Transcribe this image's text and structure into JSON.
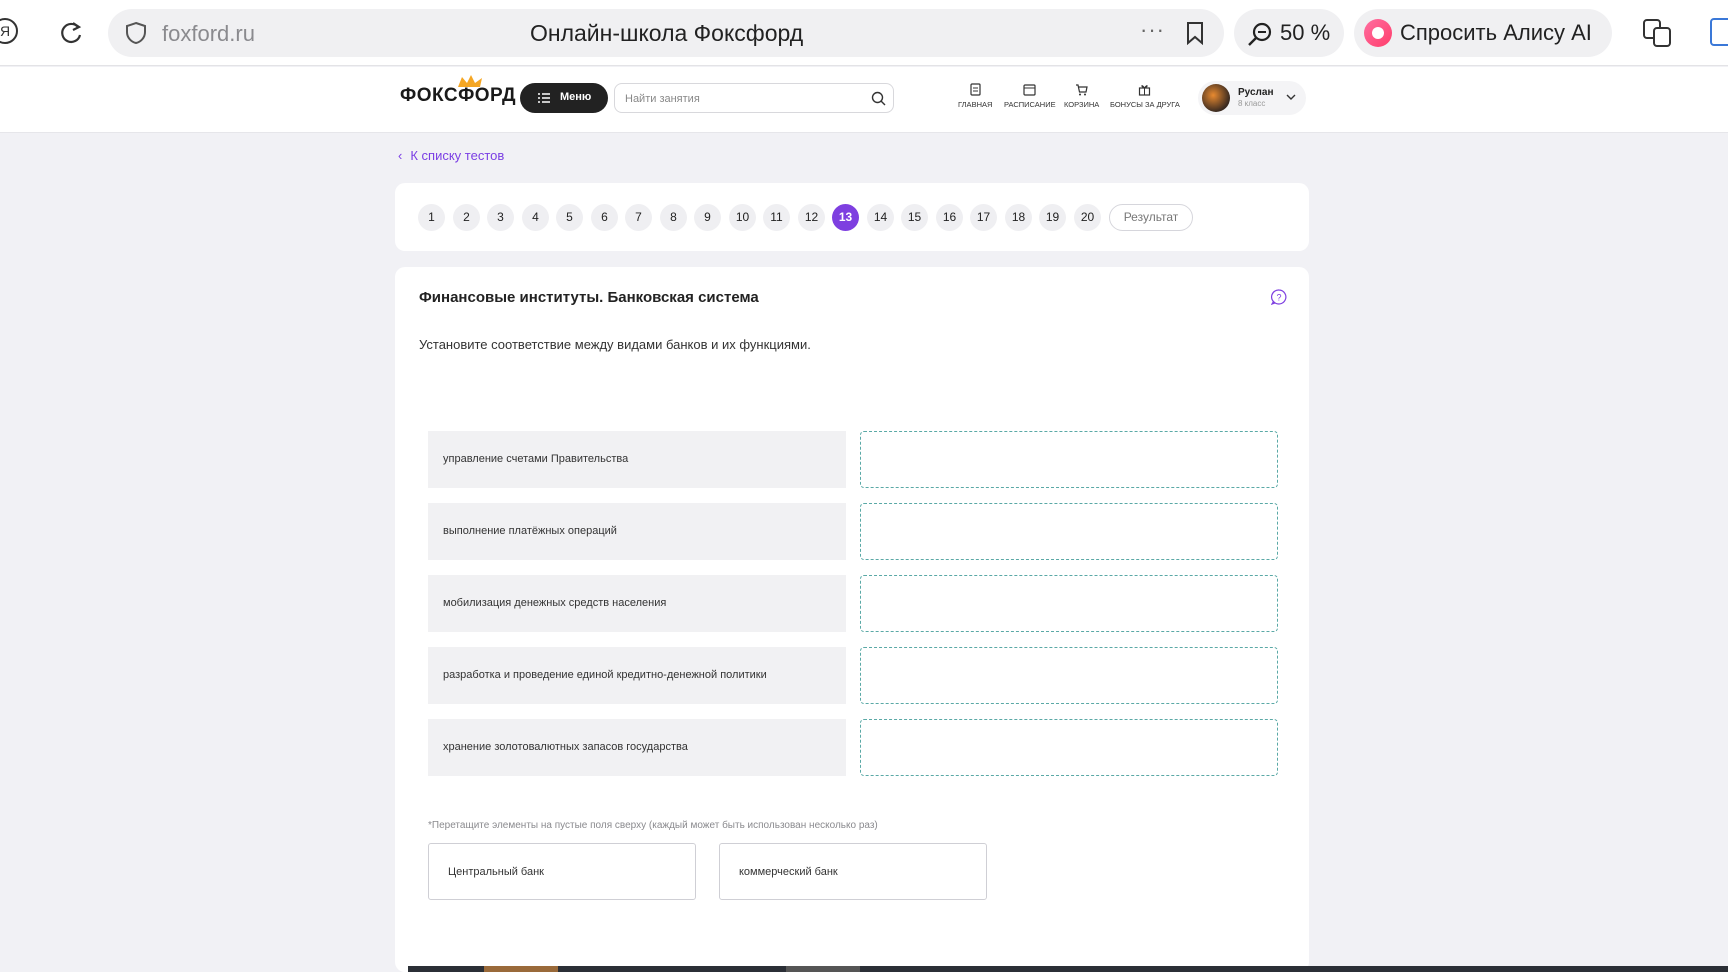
{
  "browser": {
    "host": "foxford.ru",
    "page_title": "Онлайн-школа Фоксфорд",
    "more": "···",
    "zoom": "50 %",
    "alice_label": "Спросить Алису AI"
  },
  "header": {
    "logo": "ФОКСФОРД",
    "menu_label": "Меню",
    "search_placeholder": "Найти занятия",
    "nav": {
      "home": "ГЛАВНАЯ",
      "schedule": "РАСПИСАНИЕ",
      "cart": "КОРЗИНА",
      "bonus": "БОНУСЫ ЗА ДРУГА"
    },
    "user": {
      "name": "Руслан",
      "grade": "8 класс"
    }
  },
  "back_link": "К списку тестов",
  "pager": {
    "pages": [
      "1",
      "2",
      "3",
      "4",
      "5",
      "6",
      "7",
      "8",
      "9",
      "10",
      "11",
      "12",
      "13",
      "14",
      "15",
      "16",
      "17",
      "18",
      "19",
      "20"
    ],
    "active": "13",
    "result_label": "Результат"
  },
  "question": {
    "title": "Финансовые институты. Банковская система",
    "text": "Установите соответствие между видами банков и их функциями.",
    "rows": [
      "управление счетами Правительства",
      "выполнение платёжных операций",
      "мобилизация денежных средств населения",
      "разработка и проведение единой кредитно-денежной политики",
      "хранение золотовалютных запасов государства"
    ],
    "hint": "*Перетащите элементы на пустые поля сверху (каждый может быть использован несколько раз)",
    "options": [
      "Центральный банк",
      "коммерческий банк"
    ]
  }
}
